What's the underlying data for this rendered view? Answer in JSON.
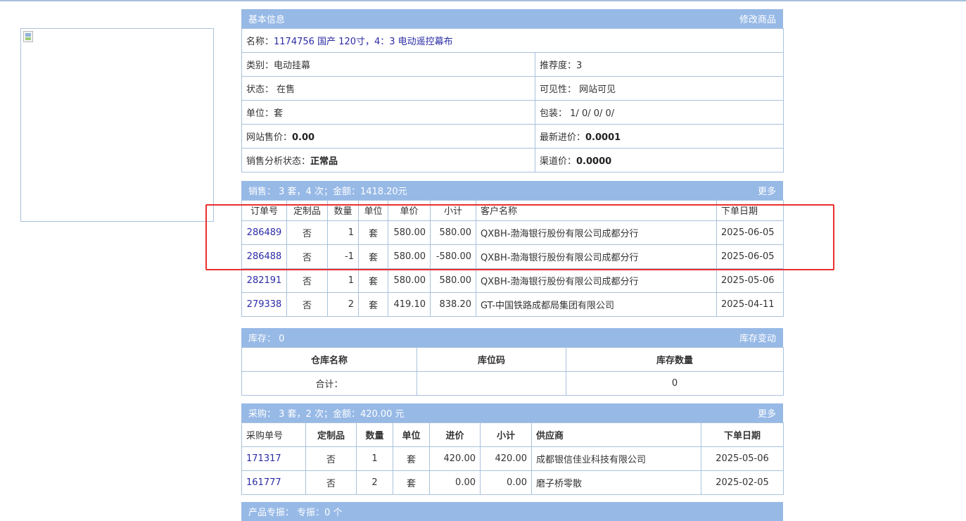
{
  "basic": {
    "header_title": "基本信息",
    "header_action": "修改商品",
    "name_label": "名称：",
    "name_value": "1174756 国产 120寸，4：3 电动遥控幕布",
    "category_label": "类别：",
    "category_value": "电动挂幕",
    "recommend_label": "推荐度：",
    "recommend_value": "3",
    "status_label": "状态：",
    "status_value": "在售",
    "visibility_label": "可见性：",
    "visibility_value": "网站可见",
    "unit_label": "单位：",
    "unit_value": "套",
    "package_label": "包装：",
    "package_value": "1/ 0/ 0/ 0/",
    "site_price_label": "网站售价：",
    "site_price_value": "0.00",
    "latest_cost_label": "最新进价：",
    "latest_cost_value": "0.0001",
    "sales_status_label": "销售分析状态：",
    "sales_status_value": "正常品",
    "channel_price_label": "渠道价：",
    "channel_price_value": "0.0000"
  },
  "sales": {
    "header_title": "销售：   3 套，4 次；金额：1418.20元",
    "header_action": "更多",
    "columns": [
      "订单号",
      "定制品",
      "数量",
      "单位",
      "单价",
      "小计",
      "客户名称",
      "下单日期"
    ],
    "rows": [
      {
        "order": "286489",
        "custom": "否",
        "qty": "1",
        "unit": "套",
        "price": "580.00",
        "subtotal": "580.00",
        "customer": "QXBH-渤海银行股份有限公司成都分行",
        "date": "2025-06-05"
      },
      {
        "order": "286488",
        "custom": "否",
        "qty": "-1",
        "unit": "套",
        "price": "580.00",
        "subtotal": "-580.00",
        "customer": "QXBH-渤海银行股份有限公司成都分行",
        "date": "2025-06-05"
      },
      {
        "order": "282191",
        "custom": "否",
        "qty": "1",
        "unit": "套",
        "price": "580.00",
        "subtotal": "580.00",
        "customer": "QXBH-渤海银行股份有限公司成都分行",
        "date": "2025-05-06"
      },
      {
        "order": "279338",
        "custom": "否",
        "qty": "2",
        "unit": "套",
        "price": "419.10",
        "subtotal": "838.20",
        "customer": "GT-中国铁路成都局集团有限公司",
        "date": "2025-04-11"
      }
    ]
  },
  "stock": {
    "header_title": "库存：   0",
    "header_action": "库存变动",
    "columns": [
      "仓库名称",
      "库位码",
      "库存数量"
    ],
    "total_label": "合计：",
    "total_location": "",
    "total_qty": "0"
  },
  "purchase": {
    "header_title": "采购：   3 套，2 次；金额：420.00 元",
    "header_action": "更多",
    "columns": [
      "采购单号",
      "定制品",
      "数量",
      "单位",
      "进价",
      "小计",
      "供应商",
      "下单日期"
    ],
    "rows": [
      {
        "order": "171317",
        "custom": "否",
        "qty": "1",
        "unit": "套",
        "price": "420.00",
        "subtotal": "420.00",
        "supplier": "成都银信佳业科技有限公司",
        "date": "2025-05-06"
      },
      {
        "order": "161777",
        "custom": "否",
        "qty": "2",
        "unit": "套",
        "price": "0.00",
        "subtotal": "0.00",
        "supplier": "磨子桥零散",
        "date": "2025-02-05"
      }
    ]
  },
  "bottom": {
    "header_title": "产品专振：   专振：0 个"
  },
  "colors": {
    "header_bg": "#97b9e6",
    "border": "#a9c2dd",
    "link": "#2b2ba5",
    "highlight": "#e8302f"
  }
}
